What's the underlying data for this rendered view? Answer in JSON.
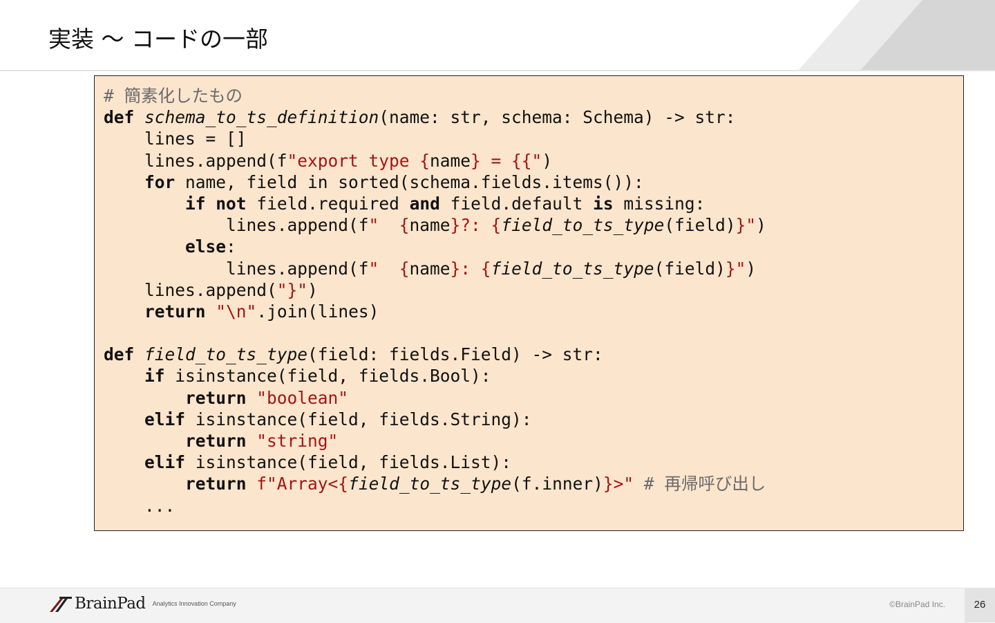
{
  "slide": {
    "title": "実装 〜 コードの一部",
    "page_number": "26",
    "copyright": "©BrainPad Inc.",
    "logo_text": "BrainPad",
    "tagline": "Analytics Innovation Company"
  },
  "code": {
    "language": "python",
    "lines": [
      [
        {
          "t": "# 簡素化したもの",
          "c": "cm"
        }
      ],
      [
        {
          "t": "def",
          "c": "kw"
        },
        {
          "t": " "
        },
        {
          "t": "schema_to_ts_definition",
          "c": "fn"
        },
        {
          "t": "(name: str, schema: Schema) -> str:"
        }
      ],
      [
        {
          "t": "    lines = []"
        }
      ],
      [
        {
          "t": "    lines.append(f"
        },
        {
          "t": "\"export type {",
          "c": "str"
        },
        {
          "t": "name"
        },
        {
          "t": "} = {{\"",
          "c": "str"
        },
        {
          "t": ")"
        }
      ],
      [
        {
          "t": "    "
        },
        {
          "t": "for",
          "c": "kw"
        },
        {
          "t": " name, field in sorted(schema.fields.items()):"
        }
      ],
      [
        {
          "t": "        "
        },
        {
          "t": "if",
          "c": "kw"
        },
        {
          "t": " "
        },
        {
          "t": "not",
          "c": "kw"
        },
        {
          "t": " field.required "
        },
        {
          "t": "and",
          "c": "kw"
        },
        {
          "t": " field.default "
        },
        {
          "t": "is",
          "c": "kw"
        },
        {
          "t": " missing:"
        }
      ],
      [
        {
          "t": "            lines.append(f"
        },
        {
          "t": "\"  {",
          "c": "str"
        },
        {
          "t": "name"
        },
        {
          "t": "}?: {",
          "c": "str"
        },
        {
          "t": "field_to_ts_type",
          "c": "fn"
        },
        {
          "t": "(field)"
        },
        {
          "t": "}\"",
          "c": "str"
        },
        {
          "t": ")"
        }
      ],
      [
        {
          "t": "        "
        },
        {
          "t": "else",
          "c": "kw"
        },
        {
          "t": ":"
        }
      ],
      [
        {
          "t": "            lines.append(f"
        },
        {
          "t": "\"  {",
          "c": "str"
        },
        {
          "t": "name"
        },
        {
          "t": "}: {",
          "c": "str"
        },
        {
          "t": "field_to_ts_type",
          "c": "fn"
        },
        {
          "t": "(field)"
        },
        {
          "t": "}\"",
          "c": "str"
        },
        {
          "t": ")"
        }
      ],
      [
        {
          "t": "    lines.append("
        },
        {
          "t": "\"}\"",
          "c": "str"
        },
        {
          "t": ")"
        }
      ],
      [
        {
          "t": "    "
        },
        {
          "t": "return",
          "c": "kw"
        },
        {
          "t": " "
        },
        {
          "t": "\"\\n\"",
          "c": "str"
        },
        {
          "t": ".join(lines)"
        }
      ],
      [
        {
          "t": ""
        }
      ],
      [
        {
          "t": "def",
          "c": "kw"
        },
        {
          "t": " "
        },
        {
          "t": "field_to_ts_type",
          "c": "fn"
        },
        {
          "t": "(field: fields.Field) -> str:"
        }
      ],
      [
        {
          "t": "    "
        },
        {
          "t": "if",
          "c": "kw"
        },
        {
          "t": " isinstance(field, fields.Bool):"
        }
      ],
      [
        {
          "t": "        "
        },
        {
          "t": "return",
          "c": "kw"
        },
        {
          "t": " "
        },
        {
          "t": "\"boolean\"",
          "c": "str"
        }
      ],
      [
        {
          "t": "    "
        },
        {
          "t": "elif",
          "c": "kw"
        },
        {
          "t": " isinstance(field, fields.String):"
        }
      ],
      [
        {
          "t": "        "
        },
        {
          "t": "return",
          "c": "kw"
        },
        {
          "t": " "
        },
        {
          "t": "\"string\"",
          "c": "str"
        }
      ],
      [
        {
          "t": "    "
        },
        {
          "t": "elif",
          "c": "kw"
        },
        {
          "t": " isinstance(field, fields.List):"
        }
      ],
      [
        {
          "t": "        "
        },
        {
          "t": "return",
          "c": "kw"
        },
        {
          "t": " "
        },
        {
          "t": "f\"Array<{",
          "c": "str"
        },
        {
          "t": "field_to_ts_type",
          "c": "fn"
        },
        {
          "t": "(f.inner)"
        },
        {
          "t": "}>\"",
          "c": "str"
        },
        {
          "t": " "
        },
        {
          "t": "# 再帰呼び出し",
          "c": "cm"
        }
      ],
      [
        {
          "t": "    ..."
        }
      ]
    ]
  },
  "colors": {
    "code_background": "#fbe5cd",
    "string": "#a31515",
    "comment": "#6b6b6b"
  }
}
